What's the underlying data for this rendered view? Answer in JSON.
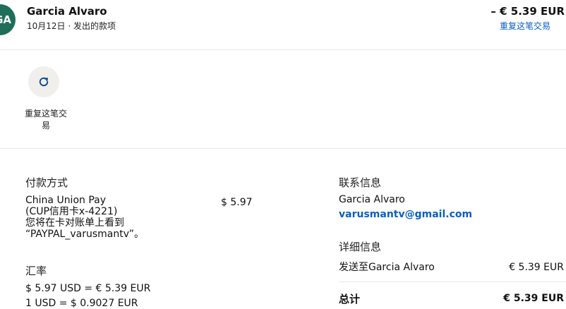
{
  "header": {
    "avatar_initials": "GA",
    "name": "Garcia Alvaro",
    "subtitle": "10月12日 · 发出的款项",
    "amount": "– € 5.39 EUR",
    "repeat_link": "重复这笔交易"
  },
  "action": {
    "icon": "refresh-icon",
    "label": "重复这笔交易"
  },
  "payment_method": {
    "title": "付款方式",
    "lines": [
      "China Union Pay",
      "(CUP信用卡x-4221)",
      "您将在卡对账单上看到",
      "“PAYPAL_varusmantv”。"
    ],
    "amount": "$ 5.97"
  },
  "exchange_rate": {
    "title": "汇率",
    "line1": "$ 5.97 USD = € 5.39 EUR",
    "line2": "1 USD = $ 0.9027 EUR"
  },
  "contact": {
    "title": "联系信息",
    "name": "Garcia Alvaro",
    "email": "varusmantv@gmail.com"
  },
  "details": {
    "title": "详细信息",
    "sent_to": "发送至Garcia Alvaro",
    "sent_amount": "€ 5.39 EUR",
    "total_label": "总计",
    "total_amount": "€ 5.39 EUR"
  },
  "colors": {
    "avatar": "#1f6e5a",
    "link": "#0a5fc2"
  }
}
